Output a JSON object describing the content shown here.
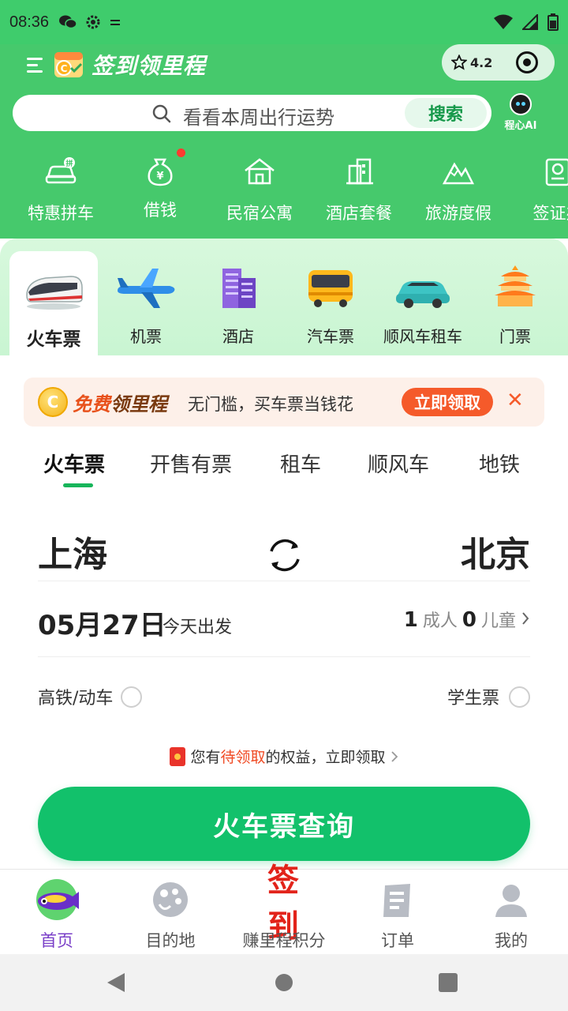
{
  "status_bar": {
    "time": "08:36"
  },
  "header": {
    "title": "签到领里程",
    "rating": "4.2",
    "search": {
      "placeholder": "看看本周出行运势",
      "button": "搜索"
    },
    "ai_label": "程心AI",
    "quick_links": [
      {
        "label": "特惠拼车",
        "icon": "carpool-icon"
      },
      {
        "label": "借钱",
        "icon": "money-bag-icon"
      },
      {
        "label": "民宿公寓",
        "icon": "house-icon"
      },
      {
        "label": "酒店套餐",
        "icon": "building-icon"
      },
      {
        "label": "旅游度假",
        "icon": "mountain-icon"
      },
      {
        "label": "签证办",
        "icon": "passport-icon"
      }
    ]
  },
  "categories": [
    {
      "label": "火车票",
      "active": true
    },
    {
      "label": "机票"
    },
    {
      "label": "酒店"
    },
    {
      "label": "汽车票"
    },
    {
      "label": "顺风车租车"
    },
    {
      "label": "门票"
    }
  ],
  "promo": {
    "title_a": "免费",
    "title_b": "领里程",
    "coin": "C",
    "desc": "无门槛，买车票当钱花",
    "button": "立即领取",
    "close": "✕"
  },
  "sub_tabs": [
    "火车票",
    "开售有票",
    "租车",
    "顺风车",
    "地铁"
  ],
  "booking": {
    "from": "上海",
    "to": "北京",
    "date": "05月27日",
    "date_note": "今天出发",
    "adult_count": "1",
    "adult_label": "成人",
    "child_count": "0",
    "child_label": "儿童",
    "option_left": "高铁/动车",
    "option_right": "学生票"
  },
  "benefit": {
    "prefix": "您有",
    "highlight": "待领取",
    "suffix": "的权益，立即领取"
  },
  "search_button": "火车票查询",
  "bottom_nav": [
    {
      "label": "首页",
      "active": true
    },
    {
      "label": "目的地"
    },
    {
      "label": "赚里程积分",
      "big": "签到"
    },
    {
      "label": "订单"
    },
    {
      "label": "我的"
    }
  ],
  "colors": {
    "brand_green": "#46c96c",
    "cta_green": "#12c16b",
    "promo_orange": "#f55a2a",
    "active_purple": "#7a3fc8"
  }
}
